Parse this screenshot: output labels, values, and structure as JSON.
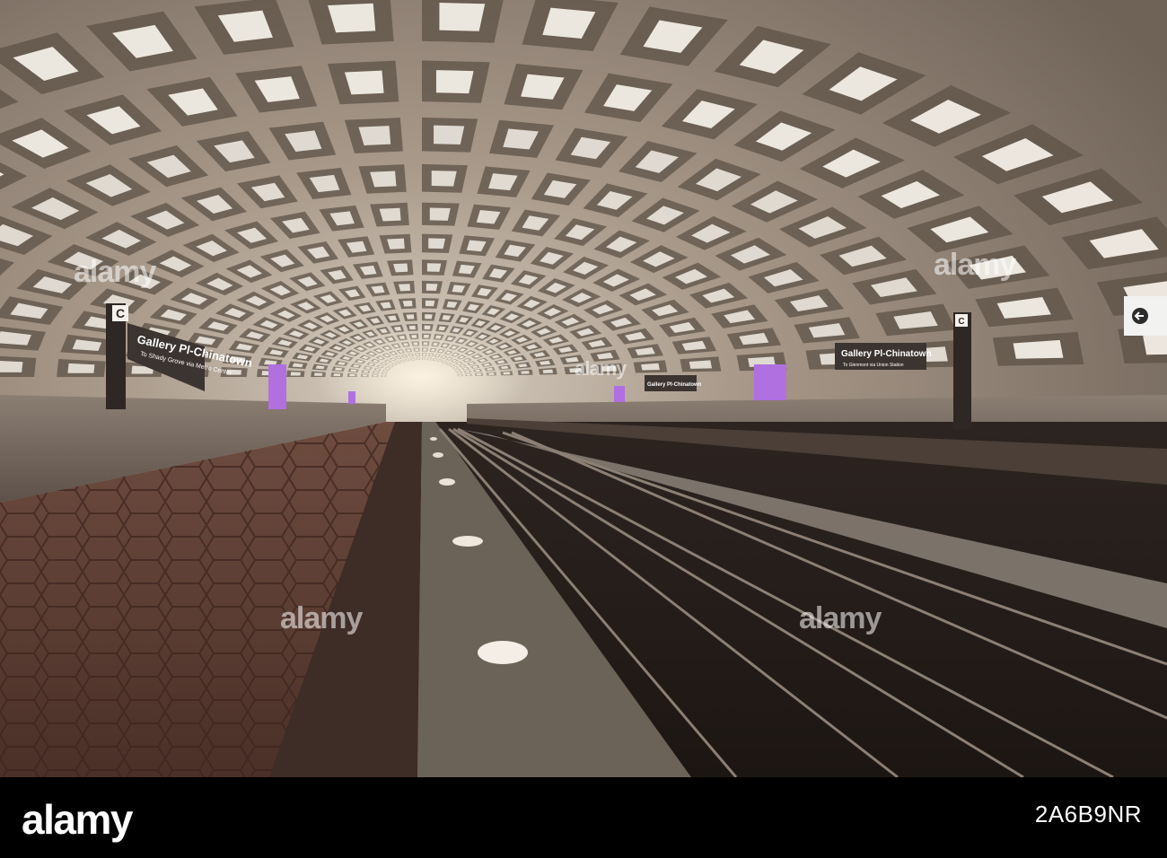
{
  "signs": {
    "left_station": "Gallery Pl-Chinatown",
    "left_sub": "To Shady Grove via Metro Center",
    "left_letter": "C",
    "right_station": "Gallery Pl-Chinatown",
    "right_sub": "To Glenmont via Union Station",
    "right_letter": "C",
    "far_station": "Gallery Pl-Chinatown"
  },
  "watermark": "alamy",
  "footer": {
    "logo": "alamy",
    "image_id": "2A6B9NR"
  },
  "colors": {
    "vault": "#8a7a6c",
    "platform_tile": "#5a3a30",
    "sign_bg": "#3c3430",
    "purple_light": "#b070e0",
    "footer_bg": "#000000"
  }
}
